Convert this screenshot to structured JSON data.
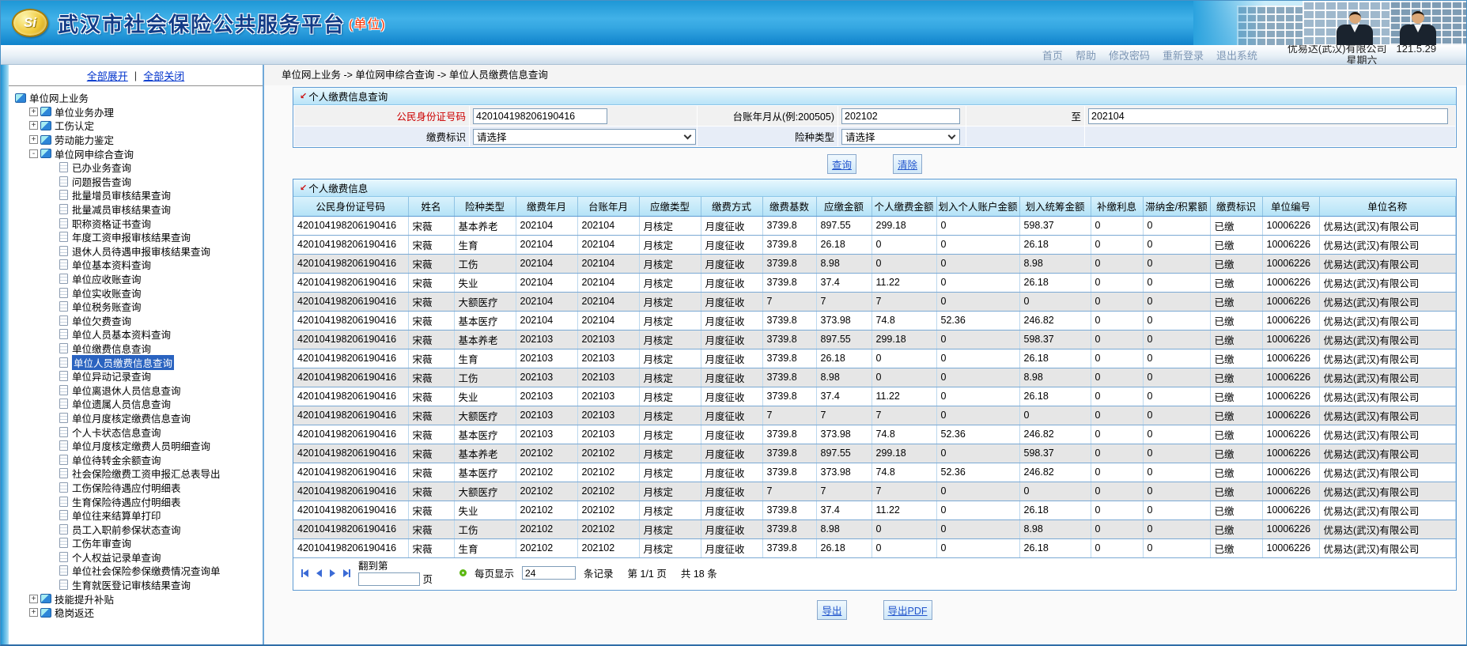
{
  "banner": {
    "logo_text": "Si",
    "title": "武汉市社会保险公共服务平台",
    "suffix": "(单位)"
  },
  "topnav": {
    "links": [
      "首页",
      "帮助",
      "修改密码",
      "重新登录",
      "退出系统"
    ],
    "company": "优易达(武汉)有限公司",
    "date": "121.5.29",
    "weekday": "星期六"
  },
  "sidebar": {
    "expand_all": "全部展开",
    "sep": "|",
    "collapse_all": "全部关闭",
    "tree": {
      "root": "单位网上业务",
      "selected": "单位人员缴费信息查询",
      "nodes": [
        {
          "label": "单位业务办理",
          "state": "collapsed"
        },
        {
          "label": "工伤认定",
          "state": "collapsed"
        },
        {
          "label": "劳动能力鉴定",
          "state": "collapsed"
        },
        {
          "label": "单位网申综合查询",
          "state": "expanded",
          "children": [
            "已办业务查询",
            "问题报告查询",
            "批量增员审核结果查询",
            "批量减员审核结果查询",
            "职称资格证书查询",
            "年度工资申报审核结果查询",
            "退休人员待遇申报审核结果查询",
            "单位基本资料查询",
            "单位应收账查询",
            "单位实收账查询",
            "单位税务账查询",
            "单位欠费查询",
            "单位人员基本资料查询",
            "单位缴费信息查询",
            "单位人员缴费信息查询",
            "单位异动记录查询",
            "单位离退休人员信息查询",
            "单位遗属人员信息查询",
            "单位月度核定缴费信息查询",
            "个人卡状态信息查询",
            "单位月度核定缴费人员明细查询",
            "单位待转金余额查询",
            "社会保险缴费工资申报汇总表导出",
            "工伤保险待遇应付明细表",
            "生育保险待遇应付明细表",
            "单位往来结算单打印",
            "员工入职前参保状态查询",
            "工伤年审查询",
            "个人权益记录单查询",
            "单位社会保险参保缴费情况查询单",
            "生育就医登记审核结果查询"
          ]
        },
        {
          "label": "技能提升补贴",
          "state": "collapsed"
        },
        {
          "label": "稳岗返还",
          "state": "collapsed"
        }
      ]
    }
  },
  "breadcrumb": {
    "text": "单位网上业务 -> 单位网申综合查询 -> 单位人员缴费信息查询"
  },
  "query": {
    "title": "个人缴费信息查询",
    "id_label": "公民身份证号码",
    "id_value": "420104198206190416",
    "from_label": "台账年月从(例:200505)",
    "from_value": "202102",
    "to_label": "至",
    "to_value": "202104",
    "flag_label": "缴费标识",
    "flag_value": "请选择",
    "ins_label": "险种类型",
    "ins_value": "请选择",
    "btn_query": "查询",
    "btn_clear": "清除"
  },
  "result": {
    "title": "个人缴费信息",
    "columns": [
      "公民身份证号码",
      "姓名",
      "险种类型",
      "缴费年月",
      "台账年月",
      "应缴类型",
      "缴费方式",
      "缴费基数",
      "应缴金额",
      "个人缴费金额",
      "划入个人账户金额",
      "划入统筹金额",
      "补缴利息",
      "滞纳金/积累额",
      "缴费标识",
      "单位编号",
      "单位名称"
    ],
    "rows": [
      [
        "420104198206190416",
        "宋薇",
        "基本养老",
        "202104",
        "202104",
        "月核定",
        "月度征收",
        "3739.8",
        "897.55",
        "299.18",
        "0",
        "598.37",
        "0",
        "0",
        "已缴",
        "10006226",
        "优易达(武汉)有限公司"
      ],
      [
        "420104198206190416",
        "宋薇",
        "生育",
        "202104",
        "202104",
        "月核定",
        "月度征收",
        "3739.8",
        "26.18",
        "0",
        "0",
        "26.18",
        "0",
        "0",
        "已缴",
        "10006226",
        "优易达(武汉)有限公司"
      ],
      [
        "420104198206190416",
        "宋薇",
        "工伤",
        "202104",
        "202104",
        "月核定",
        "月度征收",
        "3739.8",
        "8.98",
        "0",
        "0",
        "8.98",
        "0",
        "0",
        "已缴",
        "10006226",
        "优易达(武汉)有限公司"
      ],
      [
        "420104198206190416",
        "宋薇",
        "失业",
        "202104",
        "202104",
        "月核定",
        "月度征收",
        "3739.8",
        "37.4",
        "11.22",
        "0",
        "26.18",
        "0",
        "0",
        "已缴",
        "10006226",
        "优易达(武汉)有限公司"
      ],
      [
        "420104198206190416",
        "宋薇",
        "大额医疗",
        "202104",
        "202104",
        "月核定",
        "月度征收",
        "7",
        "7",
        "7",
        "0",
        "0",
        "0",
        "0",
        "已缴",
        "10006226",
        "优易达(武汉)有限公司"
      ],
      [
        "420104198206190416",
        "宋薇",
        "基本医疗",
        "202104",
        "202104",
        "月核定",
        "月度征收",
        "3739.8",
        "373.98",
        "74.8",
        "52.36",
        "246.82",
        "0",
        "0",
        "已缴",
        "10006226",
        "优易达(武汉)有限公司"
      ],
      [
        "420104198206190416",
        "宋薇",
        "基本养老",
        "202103",
        "202103",
        "月核定",
        "月度征收",
        "3739.8",
        "897.55",
        "299.18",
        "0",
        "598.37",
        "0",
        "0",
        "已缴",
        "10006226",
        "优易达(武汉)有限公司"
      ],
      [
        "420104198206190416",
        "宋薇",
        "生育",
        "202103",
        "202103",
        "月核定",
        "月度征收",
        "3739.8",
        "26.18",
        "0",
        "0",
        "26.18",
        "0",
        "0",
        "已缴",
        "10006226",
        "优易达(武汉)有限公司"
      ],
      [
        "420104198206190416",
        "宋薇",
        "工伤",
        "202103",
        "202103",
        "月核定",
        "月度征收",
        "3739.8",
        "8.98",
        "0",
        "0",
        "8.98",
        "0",
        "0",
        "已缴",
        "10006226",
        "优易达(武汉)有限公司"
      ],
      [
        "420104198206190416",
        "宋薇",
        "失业",
        "202103",
        "202103",
        "月核定",
        "月度征收",
        "3739.8",
        "37.4",
        "11.22",
        "0",
        "26.18",
        "0",
        "0",
        "已缴",
        "10006226",
        "优易达(武汉)有限公司"
      ],
      [
        "420104198206190416",
        "宋薇",
        "大额医疗",
        "202103",
        "202103",
        "月核定",
        "月度征收",
        "7",
        "7",
        "7",
        "0",
        "0",
        "0",
        "0",
        "已缴",
        "10006226",
        "优易达(武汉)有限公司"
      ],
      [
        "420104198206190416",
        "宋薇",
        "基本医疗",
        "202103",
        "202103",
        "月核定",
        "月度征收",
        "3739.8",
        "373.98",
        "74.8",
        "52.36",
        "246.82",
        "0",
        "0",
        "已缴",
        "10006226",
        "优易达(武汉)有限公司"
      ],
      [
        "420104198206190416",
        "宋薇",
        "基本养老",
        "202102",
        "202102",
        "月核定",
        "月度征收",
        "3739.8",
        "897.55",
        "299.18",
        "0",
        "598.37",
        "0",
        "0",
        "已缴",
        "10006226",
        "优易达(武汉)有限公司"
      ],
      [
        "420104198206190416",
        "宋薇",
        "基本医疗",
        "202102",
        "202102",
        "月核定",
        "月度征收",
        "3739.8",
        "373.98",
        "74.8",
        "52.36",
        "246.82",
        "0",
        "0",
        "已缴",
        "10006226",
        "优易达(武汉)有限公司"
      ],
      [
        "420104198206190416",
        "宋薇",
        "大额医疗",
        "202102",
        "202102",
        "月核定",
        "月度征收",
        "7",
        "7",
        "7",
        "0",
        "0",
        "0",
        "0",
        "已缴",
        "10006226",
        "优易达(武汉)有限公司"
      ],
      [
        "420104198206190416",
        "宋薇",
        "失业",
        "202102",
        "202102",
        "月核定",
        "月度征收",
        "3739.8",
        "37.4",
        "11.22",
        "0",
        "26.18",
        "0",
        "0",
        "已缴",
        "10006226",
        "优易达(武汉)有限公司"
      ],
      [
        "420104198206190416",
        "宋薇",
        "工伤",
        "202102",
        "202102",
        "月核定",
        "月度征收",
        "3739.8",
        "8.98",
        "0",
        "0",
        "8.98",
        "0",
        "0",
        "已缴",
        "10006226",
        "优易达(武汉)有限公司"
      ],
      [
        "420104198206190416",
        "宋薇",
        "生育",
        "202102",
        "202102",
        "月核定",
        "月度征收",
        "3739.8",
        "26.18",
        "0",
        "0",
        "26.18",
        "0",
        "0",
        "已缴",
        "10006226",
        "优易达(武汉)有限公司"
      ]
    ],
    "pagination": {
      "goto_pre": "翻到第",
      "goto_post": "页",
      "perpage_label": "每页显示",
      "perpage_value": "24",
      "records_label": "条记录",
      "page_info": "第 1/1 页",
      "total_info": "共  18  条"
    }
  },
  "footer": {
    "export_label": "导出",
    "export_pdf_label": "导出PDF"
  },
  "colors": {
    "banner_blue": "#1e97d6",
    "accent_red": "#cc0000",
    "selected_blue": "#2a63c0",
    "panel_border": "#5e9bd3"
  }
}
